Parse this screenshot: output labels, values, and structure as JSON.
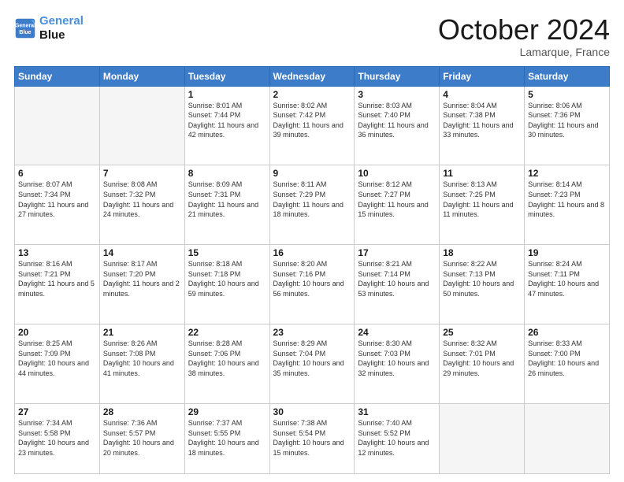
{
  "header": {
    "logo_line1": "General",
    "logo_line2": "Blue",
    "month_title": "October 2024",
    "location": "Lamarque, France"
  },
  "weekdays": [
    "Sunday",
    "Monday",
    "Tuesday",
    "Wednesday",
    "Thursday",
    "Friday",
    "Saturday"
  ],
  "weeks": [
    [
      {
        "day": "",
        "empty": true
      },
      {
        "day": "",
        "empty": true
      },
      {
        "day": "1",
        "sunrise": "8:01 AM",
        "sunset": "7:44 PM",
        "daylight": "11 hours and 42 minutes."
      },
      {
        "day": "2",
        "sunrise": "8:02 AM",
        "sunset": "7:42 PM",
        "daylight": "11 hours and 39 minutes."
      },
      {
        "day": "3",
        "sunrise": "8:03 AM",
        "sunset": "7:40 PM",
        "daylight": "11 hours and 36 minutes."
      },
      {
        "day": "4",
        "sunrise": "8:04 AM",
        "sunset": "7:38 PM",
        "daylight": "11 hours and 33 minutes."
      },
      {
        "day": "5",
        "sunrise": "8:06 AM",
        "sunset": "7:36 PM",
        "daylight": "11 hours and 30 minutes."
      }
    ],
    [
      {
        "day": "6",
        "sunrise": "8:07 AM",
        "sunset": "7:34 PM",
        "daylight": "11 hours and 27 minutes."
      },
      {
        "day": "7",
        "sunrise": "8:08 AM",
        "sunset": "7:32 PM",
        "daylight": "11 hours and 24 minutes."
      },
      {
        "day": "8",
        "sunrise": "8:09 AM",
        "sunset": "7:31 PM",
        "daylight": "11 hours and 21 minutes."
      },
      {
        "day": "9",
        "sunrise": "8:11 AM",
        "sunset": "7:29 PM",
        "daylight": "11 hours and 18 minutes."
      },
      {
        "day": "10",
        "sunrise": "8:12 AM",
        "sunset": "7:27 PM",
        "daylight": "11 hours and 15 minutes."
      },
      {
        "day": "11",
        "sunrise": "8:13 AM",
        "sunset": "7:25 PM",
        "daylight": "11 hours and 11 minutes."
      },
      {
        "day": "12",
        "sunrise": "8:14 AM",
        "sunset": "7:23 PM",
        "daylight": "11 hours and 8 minutes."
      }
    ],
    [
      {
        "day": "13",
        "sunrise": "8:16 AM",
        "sunset": "7:21 PM",
        "daylight": "11 hours and 5 minutes."
      },
      {
        "day": "14",
        "sunrise": "8:17 AM",
        "sunset": "7:20 PM",
        "daylight": "11 hours and 2 minutes."
      },
      {
        "day": "15",
        "sunrise": "8:18 AM",
        "sunset": "7:18 PM",
        "daylight": "10 hours and 59 minutes."
      },
      {
        "day": "16",
        "sunrise": "8:20 AM",
        "sunset": "7:16 PM",
        "daylight": "10 hours and 56 minutes."
      },
      {
        "day": "17",
        "sunrise": "8:21 AM",
        "sunset": "7:14 PM",
        "daylight": "10 hours and 53 minutes."
      },
      {
        "day": "18",
        "sunrise": "8:22 AM",
        "sunset": "7:13 PM",
        "daylight": "10 hours and 50 minutes."
      },
      {
        "day": "19",
        "sunrise": "8:24 AM",
        "sunset": "7:11 PM",
        "daylight": "10 hours and 47 minutes."
      }
    ],
    [
      {
        "day": "20",
        "sunrise": "8:25 AM",
        "sunset": "7:09 PM",
        "daylight": "10 hours and 44 minutes."
      },
      {
        "day": "21",
        "sunrise": "8:26 AM",
        "sunset": "7:08 PM",
        "daylight": "10 hours and 41 minutes."
      },
      {
        "day": "22",
        "sunrise": "8:28 AM",
        "sunset": "7:06 PM",
        "daylight": "10 hours and 38 minutes."
      },
      {
        "day": "23",
        "sunrise": "8:29 AM",
        "sunset": "7:04 PM",
        "daylight": "10 hours and 35 minutes."
      },
      {
        "day": "24",
        "sunrise": "8:30 AM",
        "sunset": "7:03 PM",
        "daylight": "10 hours and 32 minutes."
      },
      {
        "day": "25",
        "sunrise": "8:32 AM",
        "sunset": "7:01 PM",
        "daylight": "10 hours and 29 minutes."
      },
      {
        "day": "26",
        "sunrise": "8:33 AM",
        "sunset": "7:00 PM",
        "daylight": "10 hours and 26 minutes."
      }
    ],
    [
      {
        "day": "27",
        "sunrise": "7:34 AM",
        "sunset": "5:58 PM",
        "daylight": "10 hours and 23 minutes."
      },
      {
        "day": "28",
        "sunrise": "7:36 AM",
        "sunset": "5:57 PM",
        "daylight": "10 hours and 20 minutes."
      },
      {
        "day": "29",
        "sunrise": "7:37 AM",
        "sunset": "5:55 PM",
        "daylight": "10 hours and 18 minutes."
      },
      {
        "day": "30",
        "sunrise": "7:38 AM",
        "sunset": "5:54 PM",
        "daylight": "10 hours and 15 minutes."
      },
      {
        "day": "31",
        "sunrise": "7:40 AM",
        "sunset": "5:52 PM",
        "daylight": "10 hours and 12 minutes."
      },
      {
        "day": "",
        "empty": true
      },
      {
        "day": "",
        "empty": true
      }
    ]
  ]
}
